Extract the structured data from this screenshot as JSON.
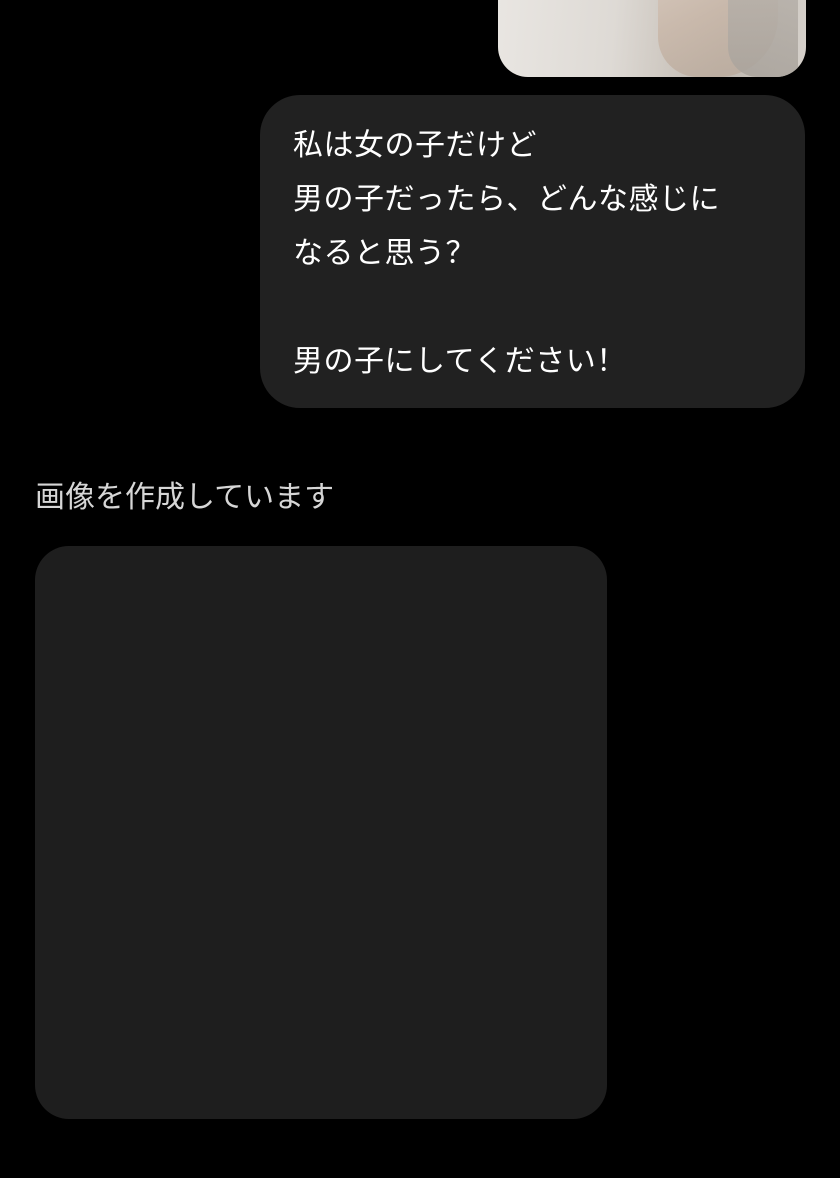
{
  "conversation": {
    "user_message": {
      "attachment_icon": "photo-thumbnail",
      "lines": [
        "私は女の子だけど",
        "男の子だったら、どんな感じに",
        "なると思う？",
        "",
        "男の子にしてください！"
      ]
    },
    "assistant_response": {
      "status_text": "画像を作成しています"
    }
  },
  "colors": {
    "background": "#000000",
    "user_bubble": "#212121",
    "image_placeholder": "#1e1e1e",
    "text_primary": "#ffffff",
    "text_status": "#d6d6d6"
  }
}
